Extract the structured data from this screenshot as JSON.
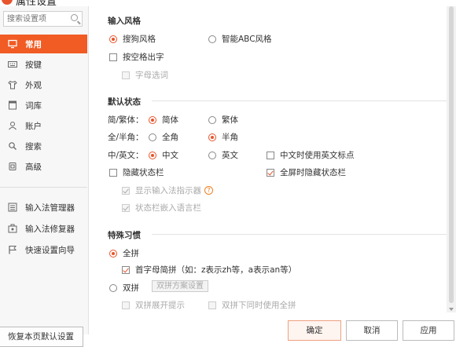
{
  "window": {
    "title": "属性设置"
  },
  "sidebar": {
    "search_placeholder": "搜索设置项",
    "items": [
      {
        "label": "常用",
        "icon": "monitor-icon"
      },
      {
        "label": "按键",
        "icon": "keyboard-icon"
      },
      {
        "label": "外观",
        "icon": "shirt-icon"
      },
      {
        "label": "词库",
        "icon": "book-icon"
      },
      {
        "label": "账户",
        "icon": "user-icon"
      },
      {
        "label": "搜索",
        "icon": "search-icon"
      },
      {
        "label": "高级",
        "icon": "advanced-icon"
      }
    ],
    "tools": [
      {
        "label": "输入法管理器",
        "icon": "manager-icon"
      },
      {
        "label": "输入法修复器",
        "icon": "repair-icon"
      },
      {
        "label": "快速设置向导",
        "icon": "flag-icon"
      }
    ],
    "restore_label": "恢复本页默认设置"
  },
  "input_style": {
    "title": "输入风格",
    "sogou": "搜狗风格",
    "abc": "智能ABC风格",
    "space_output": "按空格出字",
    "letter_select": "字母选词"
  },
  "default_state": {
    "title": "默认状态",
    "simp_trad_label": "简/繁体：",
    "simplified": "简体",
    "traditional": "繁体",
    "width_label": "全/半角：",
    "full_width": "全角",
    "half_width": "半角",
    "lang_label": "中/英文：",
    "chinese": "中文",
    "english": "英文",
    "cn_use_en_punct": "中文时使用英文标点",
    "hide_status_bar": "隐藏状态栏",
    "fullscreen_hide": "全屏时隐藏状态栏",
    "show_indicator": "显示输入法指示器",
    "embed_lang_bar": "状态栏嵌入语言栏",
    "help": "?"
  },
  "special_habits": {
    "title": "特殊习惯",
    "quanpin": "全拼",
    "initial_abbr": "首字母简拼（如：z表示zh等，a表示an等）",
    "shuangpin": "双拼",
    "scheme_button": "双拼方案设置",
    "expand_hint": "双拼展开提示",
    "also_quanpin": "双拼下同时使用全拼"
  },
  "footer": {
    "ok": "确定",
    "cancel": "取消",
    "apply": "应用"
  },
  "colors": {
    "accent": "#f15b24",
    "sidebar_bg": "#f7f7f7"
  }
}
